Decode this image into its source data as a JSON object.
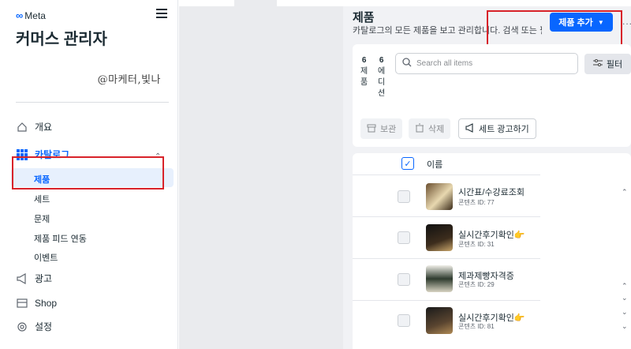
{
  "sidebar": {
    "logo_text": "Meta",
    "title": "커머스 관리자",
    "account_handle": "@마케터,빛나",
    "nav": {
      "overview": "개요",
      "catalog": "카탈로그",
      "ads": "광고",
      "shop": "Shop",
      "settings": "설정"
    },
    "catalog_sub": {
      "products": "제품",
      "sets": "세트",
      "issues": "문제",
      "product_feed": "제품 피드 연동",
      "events": "이벤트"
    }
  },
  "main": {
    "title": "제품",
    "subtitle": "카탈로그의 모든 제품을 보고 관리합니다. 검색 또는 필",
    "add_button": "제품 추가",
    "more": "...",
    "counts": {
      "products_num": "6",
      "products_label": [
        "제",
        "품"
      ],
      "editions_num": "6",
      "editions_label": [
        "에",
        "디",
        "션"
      ]
    },
    "search_placeholder": "Search all items",
    "filter_label": "필터",
    "toolbar": {
      "archive": "보관",
      "delete": "삭제",
      "advertise_set": "세트 광고하기"
    },
    "table": {
      "name_header": "이름",
      "rows": [
        {
          "name": "시간표/수강료조회",
          "id": "콘텐츠 ID: 77"
        },
        {
          "name": "실시간후기확인👉",
          "id": "콘텐츠 ID: 31"
        },
        {
          "name": "제과제빵자격증",
          "id": "콘텐츠 ID: 29"
        },
        {
          "name": "실시간후기확인👉",
          "id": "콘텐츠 ID: 81"
        }
      ]
    }
  },
  "colors": {
    "accent": "#0866ff",
    "annotation_red": "#d8232a",
    "panel_bg": "#f1f2f5"
  }
}
